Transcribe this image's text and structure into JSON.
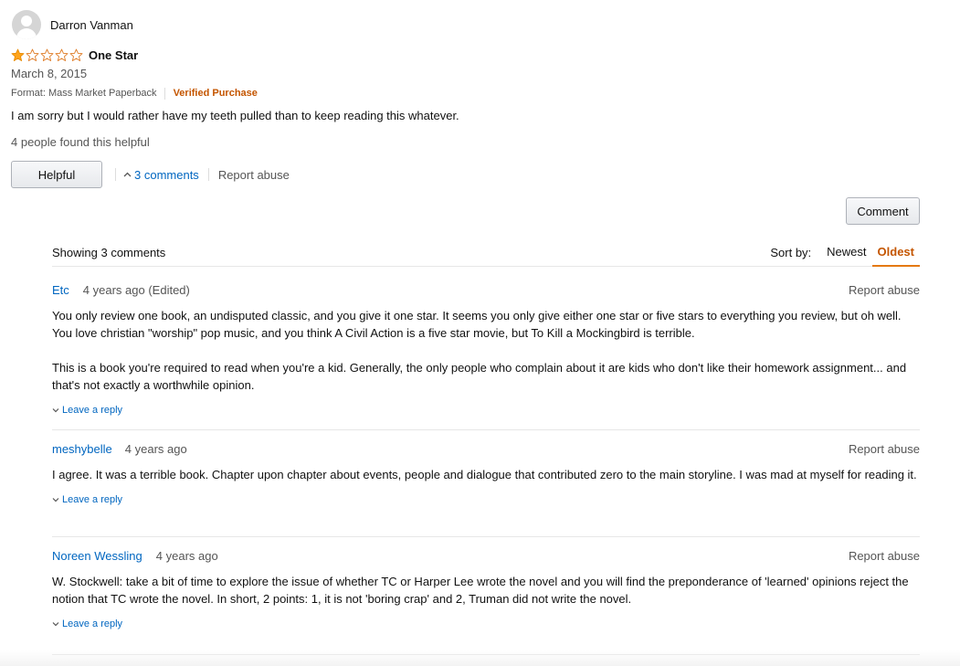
{
  "review": {
    "reviewer_name": "Darron Vanman",
    "rating": 1,
    "max_rating": 5,
    "title": "One Star",
    "date": "March 8, 2015",
    "format": "Format: Mass Market Paperback",
    "verified": "Verified Purchase",
    "body": "I am sorry but I would rather have my teeth pulled than to keep reading this whatever.",
    "helpful_count": "4 people found this helpful",
    "helpful_button": "Helpful",
    "comments_link": "3 comments",
    "report_abuse": "Report abuse",
    "comment_button": "Comment"
  },
  "comments_section": {
    "showing": "Showing 3 comments",
    "sort_label": "Sort by:",
    "sort_options": [
      "Newest",
      "Oldest"
    ],
    "sort_selected": "Oldest",
    "items": [
      {
        "author": "Etc",
        "age": "4 years ago (Edited)",
        "report": "Report abuse",
        "paragraphs": [
          "You only review one book, an undisputed classic, and you give it one star. It seems you only give either one star or five stars to everything you review, but oh well. You love christian \"worship\" pop music, and you think A Civil Action is a five star movie, but To Kill a Mockingbird is terrible.",
          "This is a book you're required to read when you're a kid. Generally, the only people who complain about it are kids who don't like their homework assignment... and that's not exactly a worthwhile opinion."
        ],
        "reply": "Leave a reply"
      },
      {
        "author": "meshybelle",
        "age": "4 years ago",
        "report": "Report abuse",
        "paragraphs": [
          "I agree. It was a terrible book. Chapter upon chapter about events, people and dialogue that contributed zero to the main storyline. I was mad at myself for reading it."
        ],
        "reply": "Leave a reply"
      },
      {
        "author": "Noreen Wessling",
        "age": "4 years ago",
        "report": "Report abuse",
        "paragraphs": [
          "W. Stockwell: take a bit of time to explore the issue of whether TC or Harper Lee wrote the novel and you will find the preponderance of 'learned' opinions reject the notion that TC wrote the novel. In short, 2 points: 1, it is not 'boring crap' and 2, Truman did not write the novel."
        ],
        "reply": "Leave a reply"
      }
    ]
  },
  "colors": {
    "link": "#0066c0",
    "verified": "#c45500",
    "star": "#ffa41c",
    "sort_active": "#c45500"
  },
  "icons": [
    "avatar-icon",
    "star-filled-icon",
    "star-empty-icon",
    "caret-up-icon",
    "chevron-down-icon"
  ]
}
